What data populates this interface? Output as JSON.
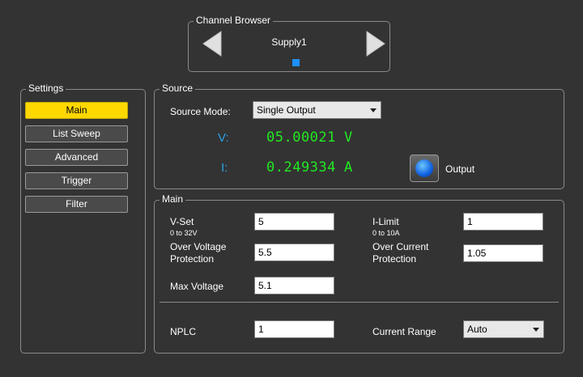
{
  "channel_browser": {
    "title": "Channel Browser",
    "channel_name": "Supply1",
    "prev_icon": "triangle-left-icon",
    "next_icon": "triangle-right-icon",
    "indicator_color": "#1e90ff"
  },
  "settings": {
    "title": "Settings",
    "items": [
      {
        "label": "Main",
        "active": true
      },
      {
        "label": "List Sweep",
        "active": false
      },
      {
        "label": "Advanced",
        "active": false
      },
      {
        "label": "Trigger",
        "active": false
      },
      {
        "label": "Filter",
        "active": false
      }
    ],
    "active_color": "#ffd800"
  },
  "source": {
    "title": "Source",
    "mode_label": "Source Mode:",
    "mode_value": "Single Output",
    "v_label": "V:",
    "v_value": "05.00021",
    "v_unit": "V",
    "i_label": "I:",
    "i_value": "0.249334",
    "i_unit": "A",
    "output_label": "Output",
    "output_icon": "output-led-icon",
    "readout_color": "#22e822",
    "label_color": "#2aa2e8"
  },
  "main": {
    "title": "Main",
    "vset_label": "V-Set",
    "vset_range": "0 to 32V",
    "vset_value": "5",
    "ilimit_label": "I-Limit",
    "ilimit_range": "0 to 10A",
    "ilimit_value": "1",
    "ovp_label_line1": "Over Voltage",
    "ovp_label_line2": "Protection",
    "ovp_value": "5.5",
    "ocp_label_line1": "Over Current",
    "ocp_label_line2": "Protection",
    "ocp_value": "1.05",
    "maxv_label": "Max Voltage",
    "maxv_value": "5.1",
    "nplc_label": "NPLC",
    "nplc_value": "1",
    "range_label": "Current Range",
    "range_value": "Auto"
  }
}
